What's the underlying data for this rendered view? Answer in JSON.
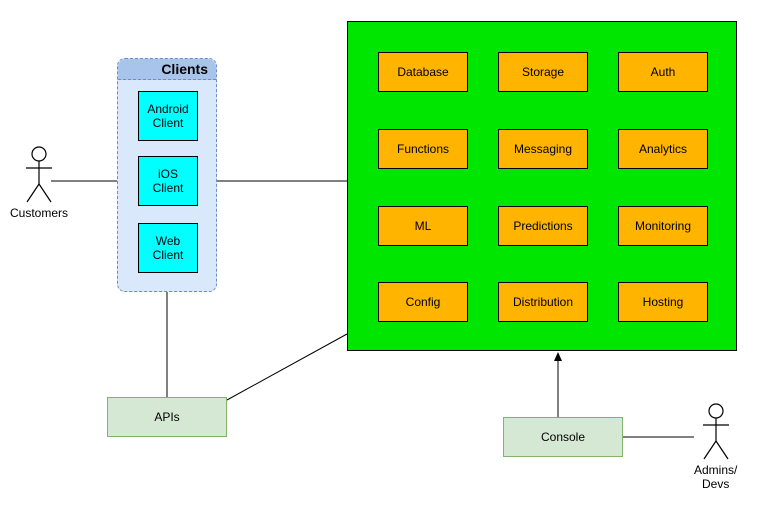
{
  "actors": {
    "customers": "Customers",
    "admins": "Admins/\nDevs"
  },
  "clients": {
    "header": "Clients",
    "items": {
      "android": "Android\nClient",
      "ios": "iOS\nClient",
      "web": "Web\nClient"
    }
  },
  "services": {
    "database": "Database",
    "storage": "Storage",
    "auth": "Auth",
    "functions": "Functions",
    "messaging": "Messaging",
    "analytics": "Analytics",
    "ml": "ML",
    "predictions": "Predictions",
    "monitoring": "Monitoring",
    "config": "Config",
    "distribution": "Distribution",
    "hosting": "Hosting"
  },
  "boxes": {
    "apis": "APIs",
    "console": "Console"
  }
}
